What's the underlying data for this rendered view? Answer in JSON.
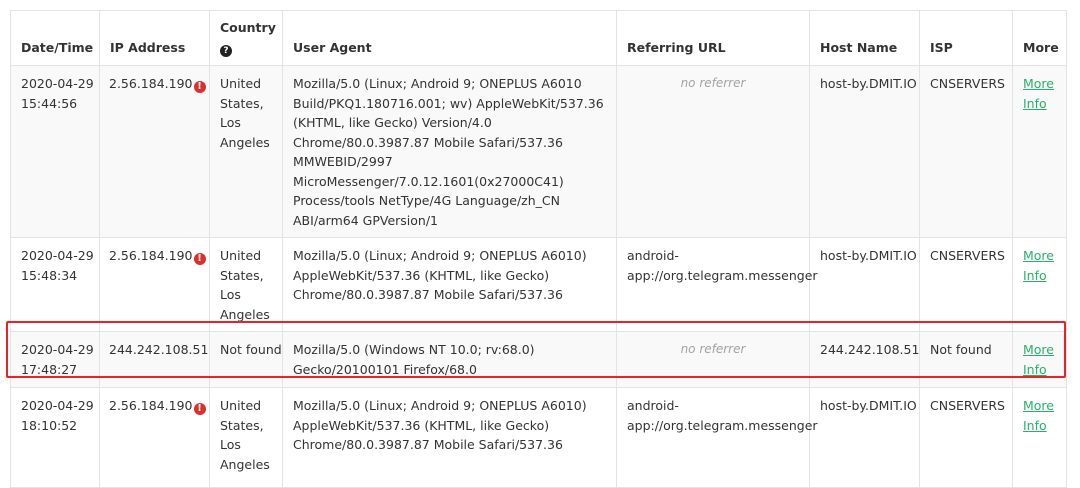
{
  "columns": {
    "datetime": "Date/Time",
    "ip": "IP Address",
    "country": "Country",
    "useragent": "User Agent",
    "referrer": "Referring URL",
    "host": "Host Name",
    "isp": "ISP",
    "more": "More"
  },
  "icons": {
    "country_help": "question-circle-icon",
    "ip_warning": "exclamation-circle-icon"
  },
  "colors": {
    "link": "#27b26a",
    "warning": "#d9302b",
    "highlight": "#e4242a",
    "muted": "#a3a3a3"
  },
  "rows": [
    {
      "date": "2020-04-29",
      "time": "15:44:56",
      "ip": "2.56.184.190",
      "ip_flag": true,
      "country": "United States, Los Angeles",
      "useragent": "Mozilla/5.0 (Linux; Android 9; ONEPLUS A6010 Build/PKQ1.180716.001; wv) AppleWebKit/537.36 (KHTML, like Gecko) Version/4.0 Chrome/80.0.3987.87 Mobile Safari/537.36 MMWEBID/2997 MicroMessenger/7.0.12.1601(0x27000C41) Process/tools NetType/4G Language/zh_CN ABI/arm64 GPVersion/1",
      "referrer": "no referrer",
      "referrer_empty": true,
      "host": "host-by.DMIT.IO",
      "isp": "CNSERVERS",
      "more": "More Info"
    },
    {
      "date": "2020-04-29",
      "time": "15:48:34",
      "ip": "2.56.184.190",
      "ip_flag": true,
      "country": "United States, Los Angeles",
      "useragent": "Mozilla/5.0 (Linux; Android 9; ONEPLUS A6010) AppleWebKit/537.36 (KHTML, like Gecko) Chrome/80.0.3987.87 Mobile Safari/537.36",
      "referrer": "android-app://org.telegram.messenger",
      "referrer_empty": false,
      "host": "host-by.DMIT.IO",
      "isp": "CNSERVERS",
      "more": "More Info"
    },
    {
      "date": "2020-04-29",
      "time": "17:48:27",
      "ip": "244.242.108.51",
      "ip_flag": false,
      "country": "Not found",
      "useragent": "Mozilla/5.0 (Windows NT 10.0; rv:68.0) Gecko/20100101 Firefox/68.0",
      "referrer": "no referrer",
      "referrer_empty": true,
      "host": "244.242.108.51",
      "isp": "Not found",
      "more": "More Info",
      "highlighted": true
    },
    {
      "date": "2020-04-29",
      "time": "18:10:52",
      "ip": "2.56.184.190",
      "ip_flag": true,
      "country": "United States, Los Angeles",
      "useragent": "Mozilla/5.0 (Linux; Android 9; ONEPLUS A6010) AppleWebKit/537.36 (KHTML, like Gecko) Chrome/80.0.3987.87 Mobile Safari/537.36",
      "referrer": "android-app://org.telegram.messenger",
      "referrer_empty": false,
      "host": "host-by.DMIT.IO",
      "isp": "CNSERVERS",
      "more": "More Info"
    }
  ]
}
